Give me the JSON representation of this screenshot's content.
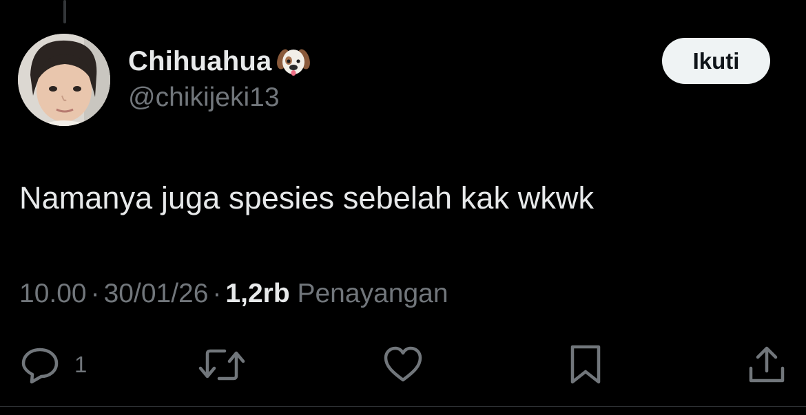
{
  "author": {
    "display_name": "Chihuahua",
    "name_emoji": "dog-face-emoji",
    "handle": "@chikijeki13",
    "avatar": "avatar-photo"
  },
  "follow_button": {
    "label": "Ikuti"
  },
  "tweet": {
    "text": "Namanya juga spesies sebelah kak wkwk"
  },
  "meta": {
    "time": "10.00",
    "separator": "·",
    "date": "30/01/26",
    "views_count": "1,2rb",
    "views_label": "Penayangan"
  },
  "actions": {
    "reply_icon": "reply-icon",
    "reply_count": "1",
    "retweet_icon": "retweet-icon",
    "like_icon": "heart-icon",
    "bookmark_icon": "bookmark-icon",
    "share_icon": "share-icon"
  },
  "colors": {
    "background": "#000000",
    "primary_text": "#e7e9ea",
    "secondary_text": "#71767b",
    "button_bg": "#eff3f4",
    "button_text": "#0f1419"
  }
}
